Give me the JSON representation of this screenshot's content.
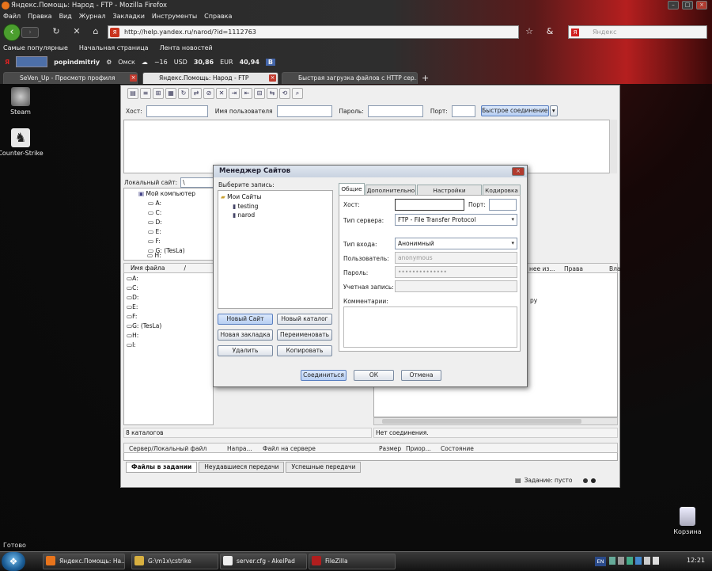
{
  "firefox": {
    "title": "Яндекс.Помощь: Народ - FTP - Mozilla Firefox",
    "menu": [
      "Файл",
      "Правка",
      "Вид",
      "Журнал",
      "Закладки",
      "Инструменты",
      "Справка"
    ],
    "url": "http://help.yandex.ru/narod/?id=1112763",
    "search_placeholder": "Яндекс",
    "bookmarks": [
      "Самые популярные",
      "Начальная страница",
      "Лента новостей"
    ],
    "yabar": {
      "user": "popindmitriy",
      "city": "Омск",
      "temp": "−16",
      "usd_label": "USD",
      "usd": "30,86",
      "eur_label": "EUR",
      "eur": "40,94"
    },
    "tabs": [
      {
        "label": "SeVen_Up - Просмотр профиля"
      },
      {
        "label": "Яндекс.Помощь: Народ - FTP"
      },
      {
        "label": "Быстрая загрузка файлов с HTTP сер..."
      }
    ],
    "new_tab": "+",
    "status": "Готово"
  },
  "desktop": {
    "icons": [
      {
        "label": "Steam"
      },
      {
        "label": "Counter-Strike"
      },
      {
        "label": "Корзина"
      }
    ]
  },
  "filezilla": {
    "quickconnect": {
      "host_label": "Хост:",
      "user_label": "Имя пользователя",
      "pass_label": "Пароль:",
      "port_label": "Порт:",
      "connect": "Быстрое соединение",
      "arrow": "▾"
    },
    "local_site_label": "Локальный сайт:",
    "local_site_value": "\\",
    "tree": [
      {
        "label": "Мой компьютер"
      },
      {
        "label": "A:"
      },
      {
        "label": "C:"
      },
      {
        "label": "D:"
      },
      {
        "label": "E:"
      },
      {
        "label": "F:"
      },
      {
        "label": "G: (TesLa)"
      },
      {
        "label": "H:"
      }
    ],
    "list_header": {
      "name": "Имя файла",
      "sort": "/"
    },
    "list": [
      "A:",
      "C:",
      "D:",
      "E:",
      "F:",
      "G: (TesLa)",
      "H:",
      "I:"
    ],
    "remote_headers": [
      "нее из...",
      "Права",
      "Вла"
    ],
    "remote_fragment": "ру",
    "local_status": "8 каталогов",
    "remote_status": "Нет соединения.",
    "queue_headers": [
      "Сервер/Локальный файл",
      "Напра...",
      "Файл на сервере",
      "Размер",
      "Приор...",
      "Состояние"
    ],
    "queue_tabs": [
      "Файлы в задании",
      "Неудавшиеся передачи",
      "Успешные передачи"
    ],
    "queue_status": "Задание: пусто"
  },
  "site_manager": {
    "title": "Менеджер Сайтов",
    "select_label": "Выберите запись:",
    "tree": {
      "root": "Мои Сайты",
      "children": [
        "testing",
        "narod"
      ]
    },
    "buttons": {
      "new_site": "Новый Сайт",
      "new_folder": "Новый каталог",
      "new_bookmark": "Новая закладка",
      "rename": "Переименовать",
      "delete": "Удалить",
      "copy": "Копировать"
    },
    "tabs": [
      "Общие",
      "Дополнительно",
      "Настройки передачи",
      "Кодировка"
    ],
    "fields": {
      "host_label": "Хост:",
      "host_value": "",
      "port_label": "Порт:",
      "port_value": "",
      "server_type_label": "Тип сервера:",
      "server_type_value": "FTP - File Transfer Protocol",
      "logon_type_label": "Тип входа:",
      "logon_type_value": "Анонимный",
      "user_label": "Пользователь:",
      "user_value": "anonymous",
      "password_label": "Пароль:",
      "password_value": "••••••••••••••",
      "account_label": "Учетная запись:",
      "account_value": "",
      "comments_label": "Комментарии:"
    },
    "footer": {
      "connect": "Соединиться",
      "ok": "ОК",
      "cancel": "Отмена"
    }
  },
  "taskbar": {
    "start": "❖",
    "items": [
      "Яндекс.Помощь: На...",
      "G:\\m1x\\cstrike",
      "server.cfg - AkelPad",
      "FileZilla"
    ],
    "lang": "EN",
    "clock": "12:21"
  }
}
